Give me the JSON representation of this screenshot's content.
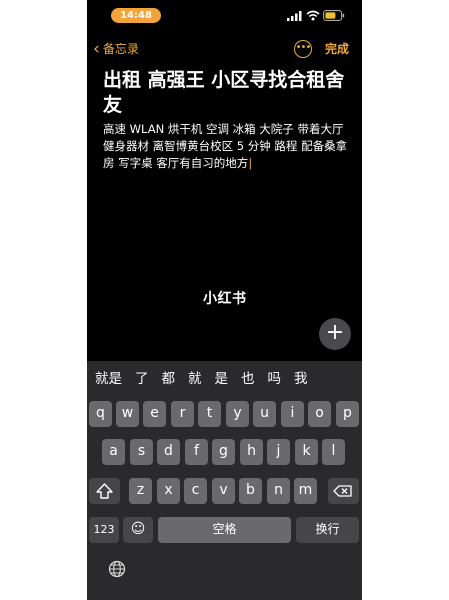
{
  "status_bar": {
    "time": "14:48"
  },
  "nav": {
    "back_chevron": "‹",
    "back_label": "备忘录",
    "more_label": "•••",
    "done_label": "完成"
  },
  "note": {
    "title": "出租 高强王 小区寻找合租舍友",
    "body": "高速 WLAN 烘干机 空调  冰箱 大院子 带着大厅 健身器材 离智博黄台校区 5 分钟 路程 配备桑拿房 写字桌 客厅有自习的地方",
    "caret": "|"
  },
  "watermark": "小红书",
  "add_button": {
    "label": "+"
  },
  "keyboard": {
    "candidates": [
      "就是",
      "了",
      "都",
      "就",
      "是",
      "也",
      "吗",
      "我"
    ],
    "row1": [
      "q",
      "w",
      "e",
      "r",
      "t",
      "y",
      "u",
      "i",
      "o",
      "p"
    ],
    "row2": [
      "a",
      "s",
      "d",
      "f",
      "g",
      "h",
      "j",
      "k",
      "l"
    ],
    "row3": [
      "z",
      "x",
      "c",
      "v",
      "b",
      "n",
      "m"
    ],
    "numbers_label": "123",
    "emoji_label": "☺",
    "space_label": "空格",
    "return_label": "换行"
  },
  "icons": {
    "shift": "shift-icon",
    "delete": "delete-icon",
    "globe": "globe-icon",
    "signal": "signal-icon",
    "wifi": "wifi-icon",
    "battery": "battery-icon"
  },
  "colors": {
    "accent": "#f0a93a",
    "time_pill": "#f2a33a",
    "background": "#000000",
    "keyboard_bg": "#2a2a2c",
    "key_light": "#6a6a6d",
    "key_dark": "#464649"
  }
}
